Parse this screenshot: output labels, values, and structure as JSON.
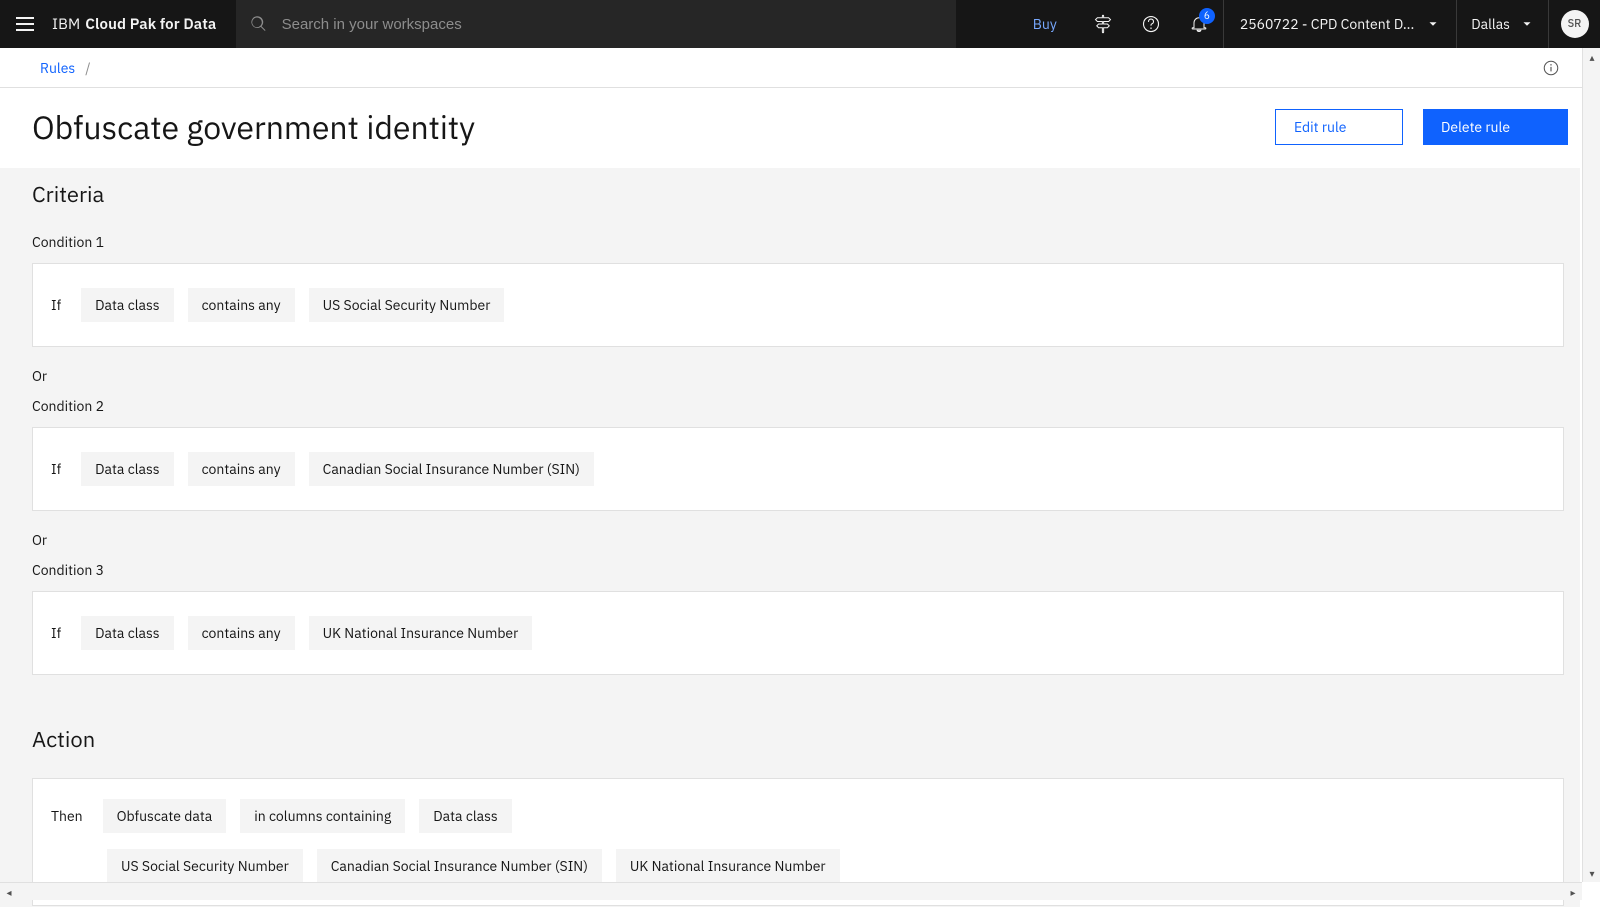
{
  "header": {
    "brand_light": "IBM",
    "brand_bold": "Cloud Pak for Data",
    "search_placeholder": "Search in your workspaces",
    "buy_label": "Buy",
    "notification_count": "6",
    "account_label": "2560722 - CPD Content D...",
    "region_label": "Dallas",
    "avatar_initials": "SR"
  },
  "breadcrumb": {
    "root": "Rules",
    "sep": "/"
  },
  "page": {
    "title": "Obfuscate government identity",
    "edit_label": "Edit rule",
    "delete_label": "Delete rule"
  },
  "criteria": {
    "heading": "Criteria",
    "or_label": "Or",
    "conditions": [
      {
        "label": "Condition 1",
        "if": "If",
        "subject": "Data class",
        "operator": "contains any",
        "value": "US Social Security Number"
      },
      {
        "label": "Condition 2",
        "if": "If",
        "subject": "Data class",
        "operator": "contains any",
        "value": "Canadian Social Insurance Number (SIN)"
      },
      {
        "label": "Condition 3",
        "if": "If",
        "subject": "Data class",
        "operator": "contains any",
        "value": "UK National Insurance Number"
      }
    ]
  },
  "action": {
    "heading": "Action",
    "then": "Then",
    "verb": "Obfuscate data",
    "scope": "in columns containing",
    "subject": "Data class",
    "values": [
      "US Social Security Number",
      "Canadian Social Insurance Number (SIN)",
      "UK National Insurance Number"
    ]
  }
}
